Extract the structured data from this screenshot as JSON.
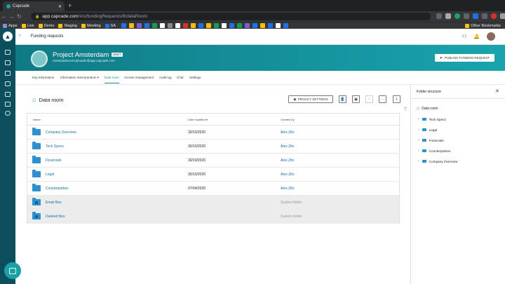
{
  "browser": {
    "tab_title": "Capcade",
    "url_domain": "app.capcade.com",
    "url_path": "/#/u/fundingRequests/8/dataRoom",
    "bookmarks": [
      "Apps",
      "Live",
      "Demo",
      "Staging",
      "Meeting",
      "SA"
    ],
    "other_bookmarks": "Other Bookmarks"
  },
  "header": {
    "title": "Funding requests"
  },
  "project": {
    "name": "Project Amsterdam",
    "badge": "DRAFT",
    "email": "roanDataRoomUploader@app.capcade.com",
    "publish_label": "PUBLISH FUNDING REQUEST"
  },
  "tabs": [
    {
      "label": "Key information"
    },
    {
      "label": "Information memorandum ▾"
    },
    {
      "label": "Data room"
    },
    {
      "label": "Access management"
    },
    {
      "label": "Audit log"
    },
    {
      "label": "Chat"
    },
    {
      "label": "Settings"
    }
  ],
  "dataroom": {
    "title": "Data room",
    "privacy_label": "PRIVACY SETTINGS"
  },
  "table": {
    "columns": [
      "Name",
      "Date modified ▾",
      "Created by"
    ],
    "rows": [
      {
        "name": "Company Overview",
        "date": "30/10/2020",
        "by": "Alex Zito"
      },
      {
        "name": "Tech Specs",
        "date": "30/10/2020",
        "by": "Alex Zito"
      },
      {
        "name": "Financials",
        "date": "30/10/2020",
        "by": "Alex Zito"
      },
      {
        "name": "Legal",
        "date": "30/10/2020",
        "by": "Alex Zito"
      },
      {
        "name": "Counterparties",
        "date": "07/04/2020",
        "by": "Alex Zito"
      },
      {
        "name": "Email files",
        "date": "",
        "by": "System folder"
      },
      {
        "name": "Deleted files",
        "date": "",
        "by": "System folder"
      }
    ]
  },
  "folder_structure": {
    "title": "Folder structure",
    "root": "Data room",
    "items": [
      "Tech Specs",
      "Legal",
      "Financials",
      "Counterparties",
      "Company Overview"
    ]
  }
}
